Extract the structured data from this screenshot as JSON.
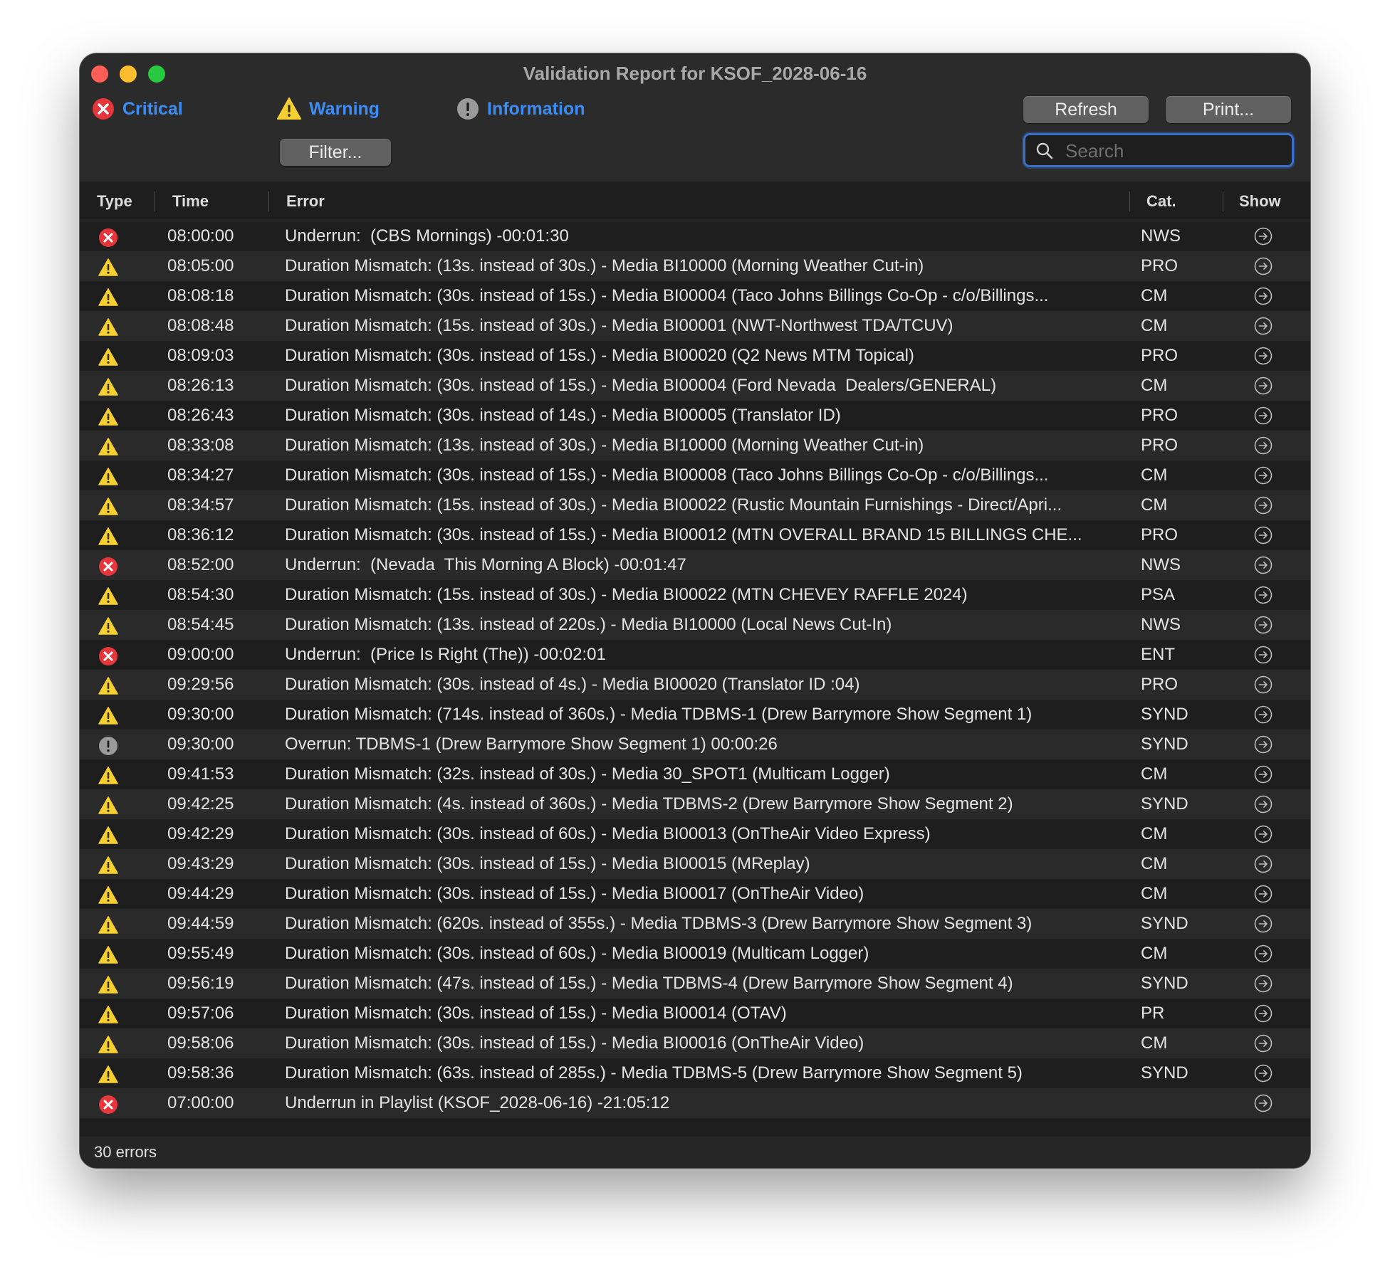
{
  "window": {
    "title": "Validation Report for KSOF_2028-06-16"
  },
  "filters": [
    {
      "label": "Critical",
      "icon": "critical-icon"
    },
    {
      "label": "Warning",
      "icon": "warning-icon"
    },
    {
      "label": "Information",
      "icon": "information-icon"
    }
  ],
  "toolbar": {
    "filter_label": "Filter...",
    "refresh_label": "Refresh",
    "print_label": "Print..."
  },
  "search": {
    "placeholder": "Search",
    "value": ""
  },
  "columns": {
    "type": "Type",
    "time": "Time",
    "error": "Error",
    "cat": "Cat.",
    "show": "Show"
  },
  "colors": {
    "critical": "#e5363b",
    "warning": "#f6cf31",
    "information": "#9a9a9a",
    "accent": "#3b8cf5"
  },
  "rows": [
    {
      "type": "critical",
      "time": "08:00:00",
      "error": "Underrun:  (CBS Mornings) -00:01:30",
      "cat": "NWS"
    },
    {
      "type": "warning",
      "time": "08:05:00",
      "error": "Duration Mismatch: (13s. instead of 30s.) - Media BI10000 (Morning Weather Cut-in)",
      "cat": "PRO"
    },
    {
      "type": "warning",
      "time": "08:08:18",
      "error": "Duration Mismatch: (30s. instead of 15s.) - Media BI00004 (Taco Johns Billings Co-Op - c/o/Billings...",
      "cat": "CM"
    },
    {
      "type": "warning",
      "time": "08:08:48",
      "error": "Duration Mismatch: (15s. instead of 30s.) - Media BI00001 (NWT-Northwest TDA/TCUV)",
      "cat": "CM"
    },
    {
      "type": "warning",
      "time": "08:09:03",
      "error": "Duration Mismatch: (30s. instead of 15s.) - Media BI00020 (Q2 News MTM Topical)",
      "cat": "PRO"
    },
    {
      "type": "warning",
      "time": "08:26:13",
      "error": "Duration Mismatch: (30s. instead of 15s.) - Media BI00004 (Ford Nevada  Dealers/GENERAL)",
      "cat": "CM"
    },
    {
      "type": "warning",
      "time": "08:26:43",
      "error": "Duration Mismatch: (30s. instead of 14s.) - Media BI00005 (Translator ID)",
      "cat": "PRO"
    },
    {
      "type": "warning",
      "time": "08:33:08",
      "error": "Duration Mismatch: (13s. instead of 30s.) - Media BI10000 (Morning Weather Cut-in)",
      "cat": "PRO"
    },
    {
      "type": "warning",
      "time": "08:34:27",
      "error": "Duration Mismatch: (30s. instead of 15s.) - Media BI00008 (Taco Johns Billings Co-Op - c/o/Billings...",
      "cat": "CM"
    },
    {
      "type": "warning",
      "time": "08:34:57",
      "error": "Duration Mismatch: (15s. instead of 30s.) - Media BI00022 (Rustic Mountain Furnishings - Direct/Apri...",
      "cat": "CM"
    },
    {
      "type": "warning",
      "time": "08:36:12",
      "error": "Duration Mismatch: (30s. instead of 15s.) - Media BI00012 (MTN OVERALL BRAND 15 BILLINGS CHE...",
      "cat": "PRO"
    },
    {
      "type": "critical",
      "time": "08:52:00",
      "error": "Underrun:  (Nevada  This Morning A Block) -00:01:47",
      "cat": "NWS"
    },
    {
      "type": "warning",
      "time": "08:54:30",
      "error": "Duration Mismatch: (15s. instead of 30s.) - Media BI00022 (MTN CHEVEY RAFFLE 2024)",
      "cat": "PSA"
    },
    {
      "type": "warning",
      "time": "08:54:45",
      "error": "Duration Mismatch: (13s. instead of 220s.) - Media BI10000 (Local News Cut-In)",
      "cat": "NWS"
    },
    {
      "type": "critical",
      "time": "09:00:00",
      "error": "Underrun:  (Price Is Right (The)) -00:02:01",
      "cat": "ENT"
    },
    {
      "type": "warning",
      "time": "09:29:56",
      "error": "Duration Mismatch: (30s. instead of 4s.) - Media BI00020 (Translator ID :04)",
      "cat": "PRO"
    },
    {
      "type": "warning",
      "time": "09:30:00",
      "error": "Duration Mismatch: (714s. instead of 360s.) - Media TDBMS-1 (Drew Barrymore Show Segment 1)",
      "cat": "SYND"
    },
    {
      "type": "information",
      "time": "09:30:00",
      "error": "Overrun: TDBMS-1 (Drew Barrymore Show Segment 1) 00:00:26",
      "cat": "SYND"
    },
    {
      "type": "warning",
      "time": "09:41:53",
      "error": "Duration Mismatch: (32s. instead of 30s.) - Media 30_SPOT1 (Multicam Logger)",
      "cat": "CM"
    },
    {
      "type": "warning",
      "time": "09:42:25",
      "error": "Duration Mismatch: (4s. instead of 360s.) - Media TDBMS-2 (Drew Barrymore Show Segment 2)",
      "cat": "SYND"
    },
    {
      "type": "warning",
      "time": "09:42:29",
      "error": "Duration Mismatch: (30s. instead of 60s.) - Media BI00013 (OnTheAir Video Express)",
      "cat": "CM"
    },
    {
      "type": "warning",
      "time": "09:43:29",
      "error": "Duration Mismatch: (30s. instead of 15s.) - Media BI00015 (MReplay)",
      "cat": "CM"
    },
    {
      "type": "warning",
      "time": "09:44:29",
      "error": "Duration Mismatch: (30s. instead of 15s.) - Media BI00017 (OnTheAir Video)",
      "cat": "CM"
    },
    {
      "type": "warning",
      "time": "09:44:59",
      "error": "Duration Mismatch: (620s. instead of 355s.) - Media TDBMS-3 (Drew Barrymore Show Segment 3)",
      "cat": "SYND"
    },
    {
      "type": "warning",
      "time": "09:55:49",
      "error": "Duration Mismatch: (30s. instead of 60s.) - Media BI00019 (Multicam Logger)",
      "cat": "CM"
    },
    {
      "type": "warning",
      "time": "09:56:19",
      "error": "Duration Mismatch: (47s. instead of 15s.) - Media TDBMS-4 (Drew Barrymore Show Segment 4)",
      "cat": "SYND"
    },
    {
      "type": "warning",
      "time": "09:57:06",
      "error": "Duration Mismatch: (30s. instead of 15s.) - Media BI00014 (OTAV)",
      "cat": "PR"
    },
    {
      "type": "warning",
      "time": "09:58:06",
      "error": "Duration Mismatch: (30s. instead of 15s.) - Media BI00016 (OnTheAir Video)",
      "cat": "CM"
    },
    {
      "type": "warning",
      "time": "09:58:36",
      "error": "Duration Mismatch: (63s. instead of 285s.) - Media TDBMS-5 (Drew Barrymore Show Segment 5)",
      "cat": "SYND"
    },
    {
      "type": "critical",
      "time": "07:00:00",
      "error": "Underrun in Playlist (KSOF_2028-06-16) -21:05:12",
      "cat": ""
    }
  ],
  "footer": {
    "count_label": "30 errors"
  }
}
